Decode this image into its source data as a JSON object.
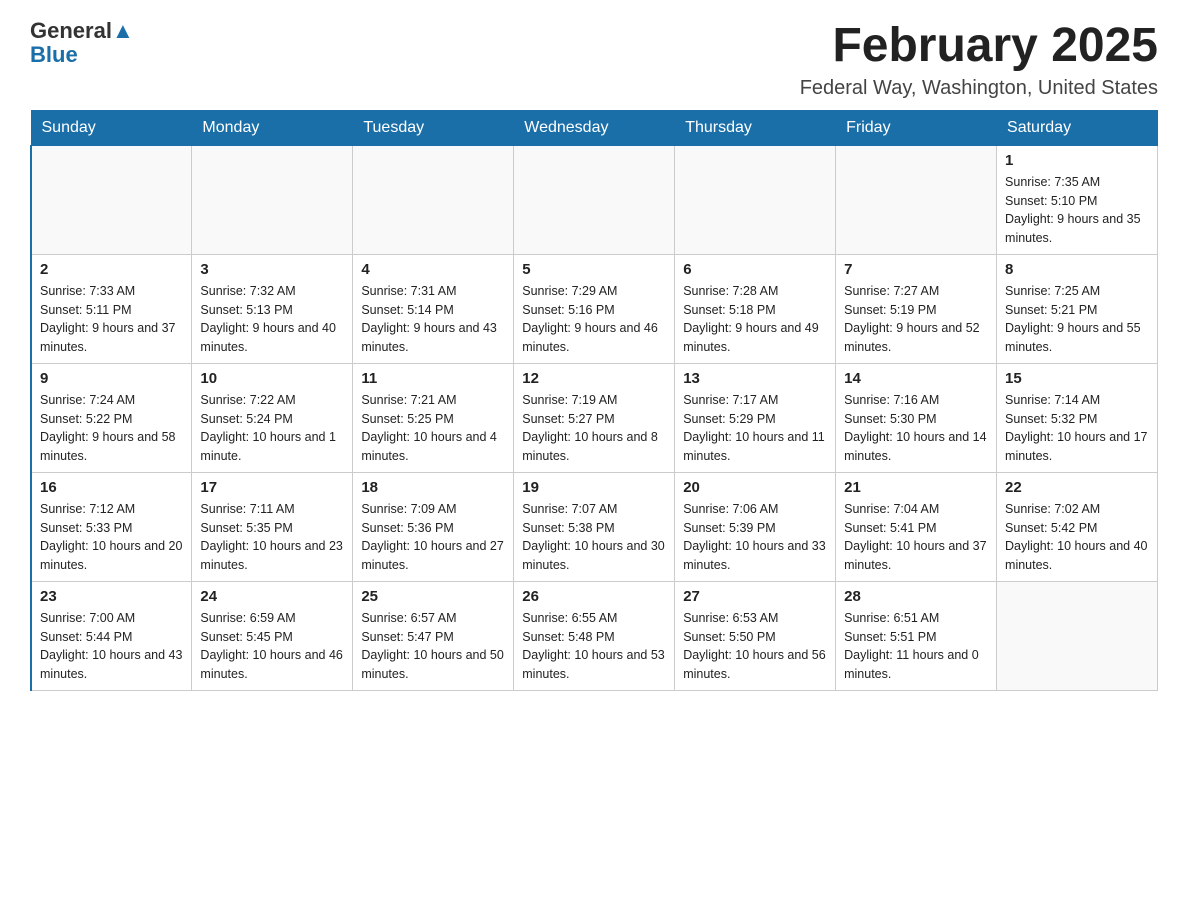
{
  "header": {
    "logo_general": "General",
    "logo_blue": "Blue",
    "month_title": "February 2025",
    "location": "Federal Way, Washington, United States"
  },
  "days_of_week": [
    "Sunday",
    "Monday",
    "Tuesday",
    "Wednesday",
    "Thursday",
    "Friday",
    "Saturday"
  ],
  "weeks": [
    [
      {
        "day": "",
        "empty": true
      },
      {
        "day": "",
        "empty": true
      },
      {
        "day": "",
        "empty": true
      },
      {
        "day": "",
        "empty": true
      },
      {
        "day": "",
        "empty": true
      },
      {
        "day": "",
        "empty": true
      },
      {
        "day": "1",
        "sunrise": "Sunrise: 7:35 AM",
        "sunset": "Sunset: 5:10 PM",
        "daylight": "Daylight: 9 hours and 35 minutes."
      }
    ],
    [
      {
        "day": "2",
        "sunrise": "Sunrise: 7:33 AM",
        "sunset": "Sunset: 5:11 PM",
        "daylight": "Daylight: 9 hours and 37 minutes."
      },
      {
        "day": "3",
        "sunrise": "Sunrise: 7:32 AM",
        "sunset": "Sunset: 5:13 PM",
        "daylight": "Daylight: 9 hours and 40 minutes."
      },
      {
        "day": "4",
        "sunrise": "Sunrise: 7:31 AM",
        "sunset": "Sunset: 5:14 PM",
        "daylight": "Daylight: 9 hours and 43 minutes."
      },
      {
        "day": "5",
        "sunrise": "Sunrise: 7:29 AM",
        "sunset": "Sunset: 5:16 PM",
        "daylight": "Daylight: 9 hours and 46 minutes."
      },
      {
        "day": "6",
        "sunrise": "Sunrise: 7:28 AM",
        "sunset": "Sunset: 5:18 PM",
        "daylight": "Daylight: 9 hours and 49 minutes."
      },
      {
        "day": "7",
        "sunrise": "Sunrise: 7:27 AM",
        "sunset": "Sunset: 5:19 PM",
        "daylight": "Daylight: 9 hours and 52 minutes."
      },
      {
        "day": "8",
        "sunrise": "Sunrise: 7:25 AM",
        "sunset": "Sunset: 5:21 PM",
        "daylight": "Daylight: 9 hours and 55 minutes."
      }
    ],
    [
      {
        "day": "9",
        "sunrise": "Sunrise: 7:24 AM",
        "sunset": "Sunset: 5:22 PM",
        "daylight": "Daylight: 9 hours and 58 minutes."
      },
      {
        "day": "10",
        "sunrise": "Sunrise: 7:22 AM",
        "sunset": "Sunset: 5:24 PM",
        "daylight": "Daylight: 10 hours and 1 minute."
      },
      {
        "day": "11",
        "sunrise": "Sunrise: 7:21 AM",
        "sunset": "Sunset: 5:25 PM",
        "daylight": "Daylight: 10 hours and 4 minutes."
      },
      {
        "day": "12",
        "sunrise": "Sunrise: 7:19 AM",
        "sunset": "Sunset: 5:27 PM",
        "daylight": "Daylight: 10 hours and 8 minutes."
      },
      {
        "day": "13",
        "sunrise": "Sunrise: 7:17 AM",
        "sunset": "Sunset: 5:29 PM",
        "daylight": "Daylight: 10 hours and 11 minutes."
      },
      {
        "day": "14",
        "sunrise": "Sunrise: 7:16 AM",
        "sunset": "Sunset: 5:30 PM",
        "daylight": "Daylight: 10 hours and 14 minutes."
      },
      {
        "day": "15",
        "sunrise": "Sunrise: 7:14 AM",
        "sunset": "Sunset: 5:32 PM",
        "daylight": "Daylight: 10 hours and 17 minutes."
      }
    ],
    [
      {
        "day": "16",
        "sunrise": "Sunrise: 7:12 AM",
        "sunset": "Sunset: 5:33 PM",
        "daylight": "Daylight: 10 hours and 20 minutes."
      },
      {
        "day": "17",
        "sunrise": "Sunrise: 7:11 AM",
        "sunset": "Sunset: 5:35 PM",
        "daylight": "Daylight: 10 hours and 23 minutes."
      },
      {
        "day": "18",
        "sunrise": "Sunrise: 7:09 AM",
        "sunset": "Sunset: 5:36 PM",
        "daylight": "Daylight: 10 hours and 27 minutes."
      },
      {
        "day": "19",
        "sunrise": "Sunrise: 7:07 AM",
        "sunset": "Sunset: 5:38 PM",
        "daylight": "Daylight: 10 hours and 30 minutes."
      },
      {
        "day": "20",
        "sunrise": "Sunrise: 7:06 AM",
        "sunset": "Sunset: 5:39 PM",
        "daylight": "Daylight: 10 hours and 33 minutes."
      },
      {
        "day": "21",
        "sunrise": "Sunrise: 7:04 AM",
        "sunset": "Sunset: 5:41 PM",
        "daylight": "Daylight: 10 hours and 37 minutes."
      },
      {
        "day": "22",
        "sunrise": "Sunrise: 7:02 AM",
        "sunset": "Sunset: 5:42 PM",
        "daylight": "Daylight: 10 hours and 40 minutes."
      }
    ],
    [
      {
        "day": "23",
        "sunrise": "Sunrise: 7:00 AM",
        "sunset": "Sunset: 5:44 PM",
        "daylight": "Daylight: 10 hours and 43 minutes."
      },
      {
        "day": "24",
        "sunrise": "Sunrise: 6:59 AM",
        "sunset": "Sunset: 5:45 PM",
        "daylight": "Daylight: 10 hours and 46 minutes."
      },
      {
        "day": "25",
        "sunrise": "Sunrise: 6:57 AM",
        "sunset": "Sunset: 5:47 PM",
        "daylight": "Daylight: 10 hours and 50 minutes."
      },
      {
        "day": "26",
        "sunrise": "Sunrise: 6:55 AM",
        "sunset": "Sunset: 5:48 PM",
        "daylight": "Daylight: 10 hours and 53 minutes."
      },
      {
        "day": "27",
        "sunrise": "Sunrise: 6:53 AM",
        "sunset": "Sunset: 5:50 PM",
        "daylight": "Daylight: 10 hours and 56 minutes."
      },
      {
        "day": "28",
        "sunrise": "Sunrise: 6:51 AM",
        "sunset": "Sunset: 5:51 PM",
        "daylight": "Daylight: 11 hours and 0 minutes."
      },
      {
        "day": "",
        "empty": true
      }
    ]
  ]
}
